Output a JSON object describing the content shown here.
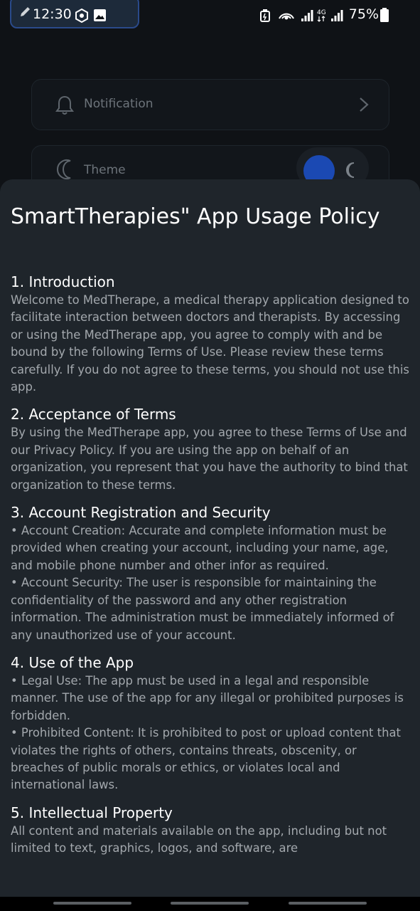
{
  "status_bar": {
    "time": "12:30",
    "battery": "75%",
    "icons": [
      "edit-pencil-icon",
      "app-badge-icon",
      "gallery-icon",
      "battery-saver-icon",
      "hotspot-icon",
      "signal-icon",
      "4g-signal-icon"
    ]
  },
  "settings": {
    "notification_label": "Notification",
    "theme_label": "Theme"
  },
  "policy": {
    "title": "SmartTherapies\" App Usage Policy",
    "sections": [
      {
        "heading": "1. Introduction",
        "paragraphs": [
          "Welcome to MedTherape, a medical therapy application designed to facilitate interaction between doctors and therapists. By accessing or using the MedTherape app, you agree to comply with and be bound by the following Terms of Use. Please review these terms carefully. If you do not agree to these terms, you should not use this app."
        ]
      },
      {
        "heading": "2. Acceptance of Terms",
        "paragraphs": [
          "By using the MedTherape app, you agree to these Terms of Use and our Privacy Policy. If you are using the app on behalf of an organization, you represent that you have the authority to bind that organization to these terms."
        ]
      },
      {
        "heading": "3. Account Registration and Security",
        "paragraphs": [
          "•  Account Creation: Accurate and complete information must be provided when creating your account, including your name, age, and mobile phone number and other infor as required.",
          "•  Account Security: The user is responsible for maintaining the confidentiality of the password and any other registration information. The administration must be immediately informed of any unauthorized use of your account."
        ]
      },
      {
        "heading": "4. Use of the App",
        "paragraphs": [
          "•  Legal Use: The app must be used in a legal and responsible manner. The use of the app for any illegal or prohibited purposes is forbidden.",
          "•  Prohibited Content: It is prohibited to post or upload content that violates the rights of others, contains threats, obscenity, or breaches of public morals or ethics, or violates local and international laws."
        ]
      },
      {
        "heading": "5. Intellectual Property",
        "paragraphs": [
          "All content and materials available on the app, including but not limited to text, graphics, logos, and software, are"
        ]
      }
    ]
  },
  "colors": {
    "accent": "#1b49b3",
    "sheet_bg": "#1f252b",
    "page_bg": "#0f1216"
  }
}
